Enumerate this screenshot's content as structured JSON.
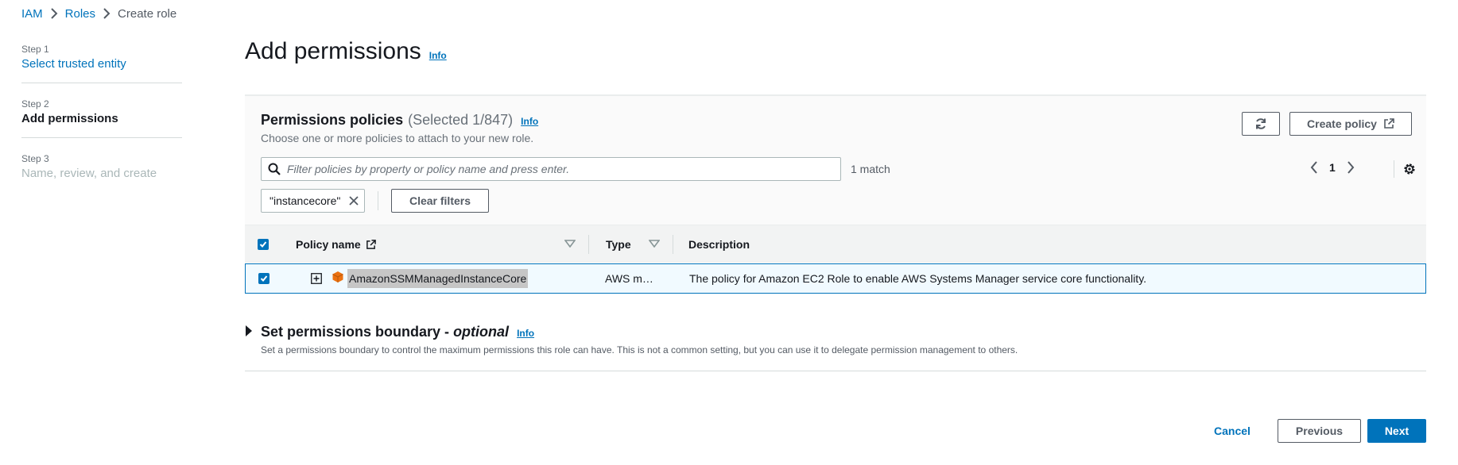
{
  "breadcrumb": {
    "items": [
      "IAM",
      "Roles"
    ],
    "current": "Create role"
  },
  "steps": [
    {
      "label": "Step 1",
      "title": "Select trusted entity"
    },
    {
      "label": "Step 2",
      "title": "Add permissions"
    },
    {
      "label": "Step 3",
      "title": "Name, review, and create"
    }
  ],
  "page": {
    "title": "Add permissions",
    "info": "Info"
  },
  "policies": {
    "title": "Permissions policies",
    "count": "(Selected 1/847)",
    "info": "Info",
    "description": "Choose one or more policies to attach to your new role.",
    "create_policy_label": "Create policy",
    "search_placeholder": "Filter policies by property or policy name and press enter.",
    "match_text": "1 match",
    "page_number": "1",
    "filter_token": "\"instancecore\"",
    "clear_filters_label": "Clear filters",
    "columns": [
      "Policy name",
      "Type",
      "Description"
    ],
    "rows": [
      {
        "name": "AmazonSSMManagedInstanceCore",
        "type": "AWS m…",
        "description": "The policy for Amazon EC2 Role to enable AWS Systems Manager service core functionality."
      }
    ]
  },
  "boundary": {
    "title": "Set permissions boundary -",
    "optional": "optional",
    "info": "Info",
    "description": "Set a permissions boundary to control the maximum permissions this role can have. This is not a common setting, but you can use it to delegate permission management to others."
  },
  "footer": {
    "cancel": "Cancel",
    "previous": "Previous",
    "next": "Next"
  },
  "colors": {
    "link": "#0073bb",
    "primary": "#0073bb",
    "policy_icon": "#ec7211",
    "selected_row_bg": "#f1faff"
  }
}
